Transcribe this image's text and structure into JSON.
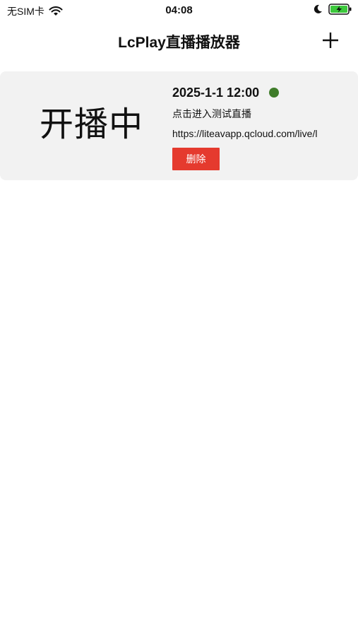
{
  "status_bar": {
    "carrier": "无SIM卡",
    "time": "04:08"
  },
  "nav": {
    "title": "LcPlay直播播放器",
    "add_icon": "plus-icon"
  },
  "streams": [
    {
      "status_label": "开播中",
      "datetime": "2025-1-1 12:00",
      "live_indicator_color": "#3f7c2a",
      "title": "点击进入测试直播",
      "url": "https://liteavapp.qcloud.com/live/l",
      "delete_label": "删除"
    }
  ],
  "colors": {
    "delete_button": "#e53a2e",
    "card_background": "#f2f2f2",
    "battery_fill": "#3cc83c"
  }
}
